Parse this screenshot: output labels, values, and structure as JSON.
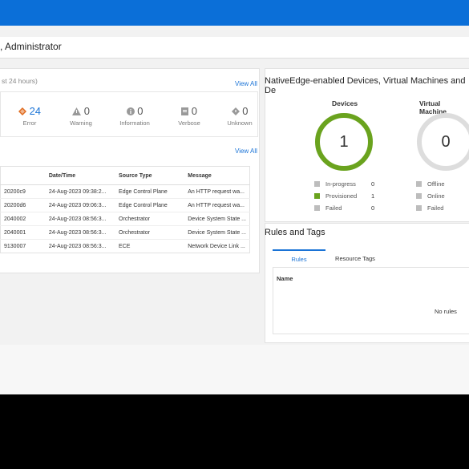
{
  "header": {
    "user_label": ", Administrator"
  },
  "events": {
    "subtitle": "st 24 hours)",
    "view_all": "View All",
    "severities": [
      {
        "count": "24",
        "label": "Error",
        "icon": "error-diamond-icon",
        "color": "#e06a1c",
        "count_color": "#1a73d6"
      },
      {
        "count": "0",
        "label": "Warning",
        "icon": "warning-triangle-icon",
        "color": "#999999",
        "count_color": "#555555"
      },
      {
        "count": "0",
        "label": "Information",
        "icon": "info-circle-icon",
        "color": "#999999",
        "count_color": "#555555"
      },
      {
        "count": "0",
        "label": "Verbose",
        "icon": "verbose-doc-icon",
        "color": "#999999",
        "count_color": "#555555"
      },
      {
        "count": "0",
        "label": "Unknown",
        "icon": "unknown-diamond-icon",
        "color": "#999999",
        "count_color": "#555555"
      }
    ],
    "alerts_view_all": "View All",
    "table": {
      "columns": [
        "",
        "Date/Time",
        "Source Type",
        "Message"
      ],
      "rows": [
        [
          "20200c9",
          "24-Aug-2023 09:38:2...",
          "Edge Control Plane",
          "An HTTP request wa..."
        ],
        [
          "20200d6",
          "24-Aug-2023 09:06:3...",
          "Edge Control Plane",
          "An HTTP request wa..."
        ],
        [
          "2040002",
          "24-Aug-2023 08:56:3...",
          "Orchestrator",
          "Device System State ..."
        ],
        [
          "2040001",
          "24-Aug-2023 08:56:3...",
          "Orchestrator",
          "Device System State ..."
        ],
        [
          "9130007",
          "24-Aug-2023 08:56:3...",
          "ECE",
          "Network Device Link ..."
        ]
      ]
    }
  },
  "devices_section": {
    "title": "NativeEdge-enabled Devices, Virtual Machines and De",
    "devices": {
      "title": "Devices",
      "value": "1",
      "ring_color": "#6aa31e",
      "legend": [
        {
          "label": "In-progress",
          "count": "0",
          "color": "#bdbdbd"
        },
        {
          "label": "Provisioned",
          "count": "1",
          "color": "#6aa31e"
        },
        {
          "label": "Failed",
          "count": "0",
          "color": "#bdbdbd"
        }
      ]
    },
    "vms": {
      "title": "Virtual Machine",
      "value": "0",
      "ring_color": "#dddddd",
      "legend": [
        {
          "label": "Offline",
          "color": "#bdbdbd"
        },
        {
          "label": "Online",
          "color": "#bdbdbd"
        },
        {
          "label": "Failed",
          "color": "#bdbdbd"
        }
      ]
    }
  },
  "rules": {
    "title": "Rules and Tags",
    "tabs": [
      "Rules",
      "Resource Tags"
    ],
    "column": "Name",
    "empty": "No rules"
  }
}
